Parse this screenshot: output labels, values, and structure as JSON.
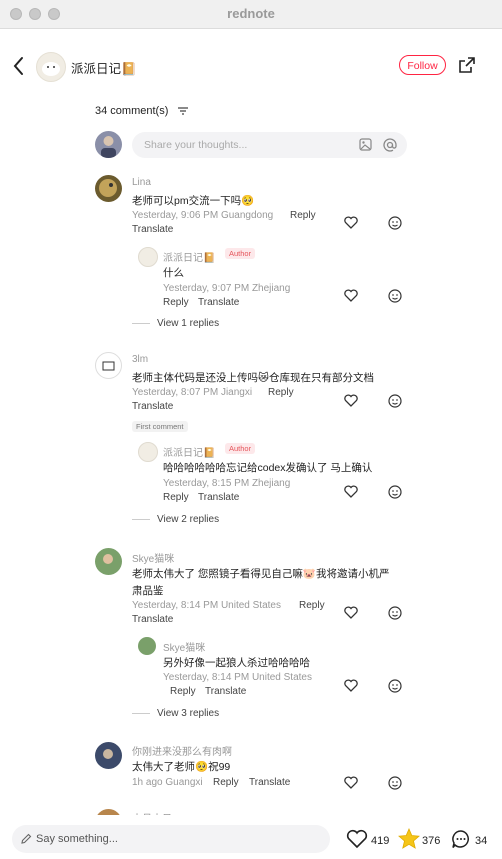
{
  "window": {
    "title": "rednote"
  },
  "header": {
    "author_name": "派派日记📔",
    "follow_label": "Follow"
  },
  "comments_count": "34 comment(s)",
  "input": {
    "placeholder": "Share your thoughts..."
  },
  "comments": [
    {
      "name": "Lina",
      "text": "老师可以pm交流一下吗🥺",
      "meta": "Yesterday, 9:06 PM Guangdong",
      "reply": "Reply",
      "translate": "Translate",
      "sub": {
        "name": "派派日记📔",
        "badge": "Author",
        "text": "什么",
        "meta": "Yesterday, 9:07 PM Zhejiang",
        "reply": "Reply",
        "translate": "Translate"
      },
      "view": "View 1 replies"
    },
    {
      "name": "3lm",
      "text": "老师主体代码是还没上传吗😿仓库现在只有部分文档",
      "meta": "Yesterday, 8:07 PM Jiangxi",
      "reply": "Reply",
      "translate": "Translate",
      "first": "First comment",
      "sub": {
        "name": "派派日记📔",
        "badge": "Author",
        "text": "哈哈哈哈哈哈忘记给codex发确认了 马上确认",
        "meta": "Yesterday, 8:15 PM Zhejiang",
        "reply": "Reply",
        "translate": "Translate"
      },
      "view": "View 2 replies"
    },
    {
      "name": "Skye猫咪",
      "text1": "老师太伟大了 您照镜子看得见自己嘛🐷我将邀请小机严",
      "text2": "肃品鉴",
      "meta": "Yesterday, 8:14 PM United States",
      "reply": "Reply",
      "translate": "Translate",
      "sub": {
        "name": "Skye猫咪",
        "text": "另外好像一起狼人杀过哈哈哈哈",
        "meta": "Yesterday, 8:14 PM United States",
        "reply": "Reply",
        "translate": "Translate"
      },
      "view": "View 3 replies"
    },
    {
      "name": "你刚进来没那么有肉啊",
      "text": "太伟大了老师🥺祝99",
      "meta": "1h ago Guangxi",
      "reply": "Reply",
      "translate": "Translate"
    },
    {
      "name": "十月十日"
    }
  ],
  "bottom": {
    "placeholder": "Say something...",
    "likes": "419",
    "stars": "376",
    "comments": "34"
  }
}
